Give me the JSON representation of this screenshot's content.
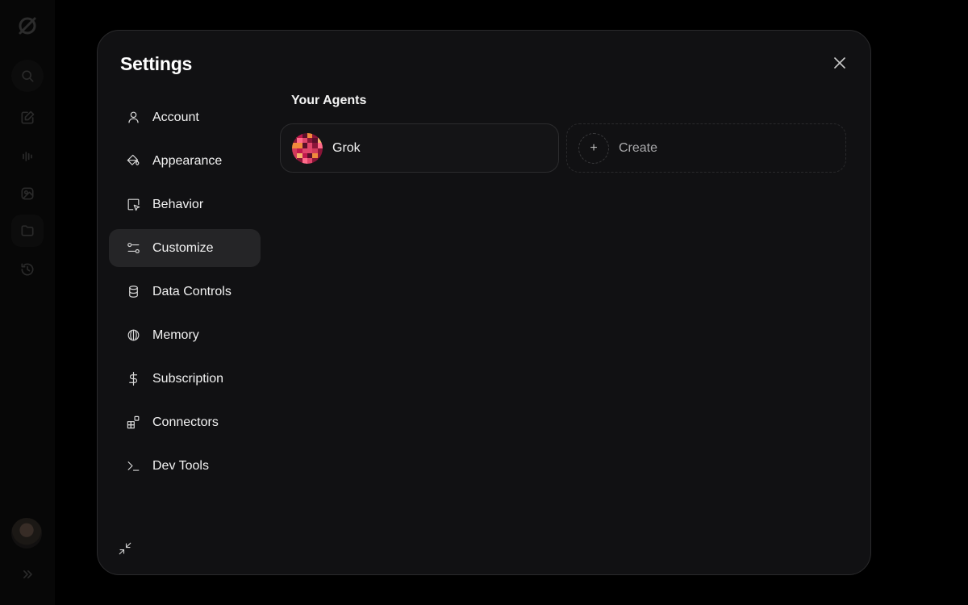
{
  "rail": {
    "icons": [
      "logo-icon",
      "search-icon",
      "new-chat-icon",
      "voice-icon",
      "image-icon",
      "projects-icon",
      "history-icon",
      "avatar",
      "expand-icon"
    ]
  },
  "settings": {
    "title": "Settings",
    "nav": [
      {
        "label": "Account",
        "icon": "user-icon"
      },
      {
        "label": "Appearance",
        "icon": "paint-bucket-icon"
      },
      {
        "label": "Behavior",
        "icon": "cursor-click-icon"
      },
      {
        "label": "Customize",
        "icon": "sliders-icon",
        "active": true
      },
      {
        "label": "Data Controls",
        "icon": "database-icon"
      },
      {
        "label": "Memory",
        "icon": "brain-icon"
      },
      {
        "label": "Subscription",
        "icon": "dollar-icon"
      },
      {
        "label": "Connectors",
        "icon": "blocks-icon"
      },
      {
        "label": "Dev Tools",
        "icon": "terminal-icon"
      }
    ]
  },
  "content": {
    "section_title": "Your Agents",
    "agents": [
      {
        "name": "Grok"
      }
    ],
    "create_label": "Create",
    "create_symbol": "+"
  },
  "colors": {
    "modal_bg": "#111113",
    "active_nav_bg": "#252527",
    "avatar_palette": [
      "#e0456a",
      "#f08a3c",
      "#c0184d",
      "#8a1538",
      "#f5b06a",
      "#5a0f2a",
      "#ff6b8a",
      "#d23a5a"
    ]
  }
}
